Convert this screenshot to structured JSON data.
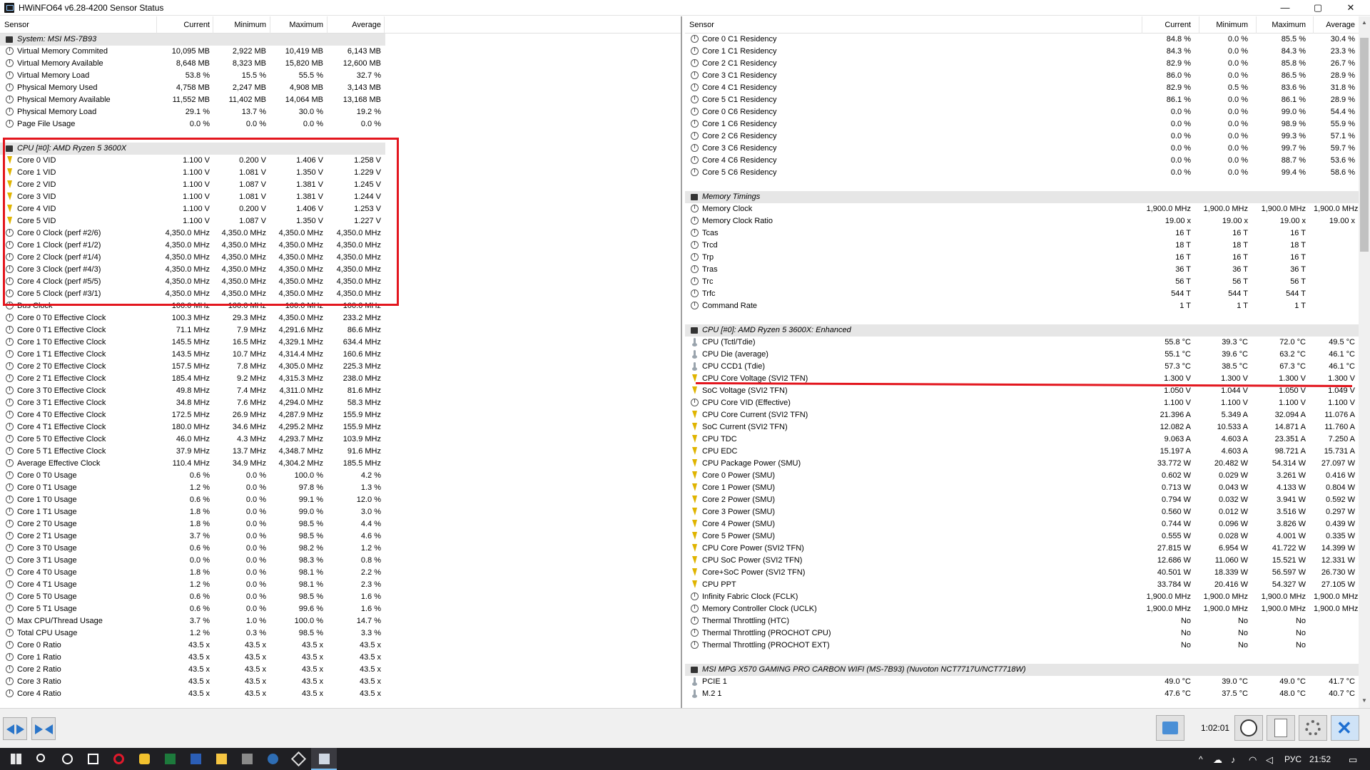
{
  "window": {
    "title": "HWiNFO64 v6.28-4200 Sensor Status",
    "minimize": "—",
    "maximize": "▢",
    "close": "✕"
  },
  "columns": {
    "sensor": "Sensor",
    "current": "Current",
    "minimum": "Minimum",
    "maximum": "Maximum",
    "average": "Average"
  },
  "left_rows": [
    {
      "t": "g",
      "n": "System: MSI MS-7B93"
    },
    {
      "i": "c",
      "n": "Virtual Memory Commited",
      "v": [
        "10,095 MB",
        "2,922 MB",
        "10,419 MB",
        "6,143 MB"
      ]
    },
    {
      "i": "c",
      "n": "Virtual Memory Available",
      "v": [
        "8,648 MB",
        "8,323 MB",
        "15,820 MB",
        "12,600 MB"
      ]
    },
    {
      "i": "c",
      "n": "Virtual Memory Load",
      "v": [
        "53.8 %",
        "15.5 %",
        "55.5 %",
        "32.7 %"
      ]
    },
    {
      "i": "c",
      "n": "Physical Memory Used",
      "v": [
        "4,758 MB",
        "2,247 MB",
        "4,908 MB",
        "3,143 MB"
      ]
    },
    {
      "i": "c",
      "n": "Physical Memory Available",
      "v": [
        "11,552 MB",
        "11,402 MB",
        "14,064 MB",
        "13,168 MB"
      ]
    },
    {
      "i": "c",
      "n": "Physical Memory Load",
      "v": [
        "29.1 %",
        "13.7 %",
        "30.0 %",
        "19.2 %"
      ]
    },
    {
      "i": "c",
      "n": "Page File Usage",
      "v": [
        "0.0 %",
        "0.0 %",
        "0.0 %",
        "0.0 %"
      ]
    },
    {
      "t": "b"
    },
    {
      "t": "g",
      "n": "CPU [#0]: AMD Ryzen 5 3600X"
    },
    {
      "i": "b",
      "n": "Core 0 VID",
      "v": [
        "1.100 V",
        "0.200 V",
        "1.406 V",
        "1.258 V"
      ]
    },
    {
      "i": "b",
      "n": "Core 1 VID",
      "v": [
        "1.100 V",
        "1.081 V",
        "1.350 V",
        "1.229 V"
      ]
    },
    {
      "i": "b",
      "n": "Core 2 VID",
      "v": [
        "1.100 V",
        "1.087 V",
        "1.381 V",
        "1.245 V"
      ]
    },
    {
      "i": "b",
      "n": "Core 3 VID",
      "v": [
        "1.100 V",
        "1.081 V",
        "1.381 V",
        "1.244 V"
      ]
    },
    {
      "i": "b",
      "n": "Core 4 VID",
      "v": [
        "1.100 V",
        "0.200 V",
        "1.406 V",
        "1.253 V"
      ]
    },
    {
      "i": "b",
      "n": "Core 5 VID",
      "v": [
        "1.100 V",
        "1.087 V",
        "1.350 V",
        "1.227 V"
      ]
    },
    {
      "i": "c",
      "n": "Core 0 Clock (perf #2/6)",
      "v": [
        "4,350.0 MHz",
        "4,350.0 MHz",
        "4,350.0 MHz",
        "4,350.0 MHz"
      ]
    },
    {
      "i": "c",
      "n": "Core 1 Clock (perf #1/2)",
      "v": [
        "4,350.0 MHz",
        "4,350.0 MHz",
        "4,350.0 MHz",
        "4,350.0 MHz"
      ]
    },
    {
      "i": "c",
      "n": "Core 2 Clock (perf #1/4)",
      "v": [
        "4,350.0 MHz",
        "4,350.0 MHz",
        "4,350.0 MHz",
        "4,350.0 MHz"
      ]
    },
    {
      "i": "c",
      "n": "Core 3 Clock (perf #4/3)",
      "v": [
        "4,350.0 MHz",
        "4,350.0 MHz",
        "4,350.0 MHz",
        "4,350.0 MHz"
      ]
    },
    {
      "i": "c",
      "n": "Core 4 Clock (perf #5/5)",
      "v": [
        "4,350.0 MHz",
        "4,350.0 MHz",
        "4,350.0 MHz",
        "4,350.0 MHz"
      ]
    },
    {
      "i": "c",
      "n": "Core 5 Clock (perf #3/1)",
      "v": [
        "4,350.0 MHz",
        "4,350.0 MHz",
        "4,350.0 MHz",
        "4,350.0 MHz"
      ]
    },
    {
      "i": "c",
      "n": "Bus Clock",
      "v": [
        "100.0 MHz",
        "100.0 MHz",
        "100.0 MHz",
        "100.0 MHz"
      ]
    },
    {
      "i": "c",
      "n": "Core 0 T0 Effective Clock",
      "v": [
        "100.3 MHz",
        "29.3 MHz",
        "4,350.0 MHz",
        "233.2 MHz"
      ]
    },
    {
      "i": "c",
      "n": "Core 0 T1 Effective Clock",
      "v": [
        "71.1 MHz",
        "7.9 MHz",
        "4,291.6 MHz",
        "86.6 MHz"
      ]
    },
    {
      "i": "c",
      "n": "Core 1 T0 Effective Clock",
      "v": [
        "145.5 MHz",
        "16.5 MHz",
        "4,329.1 MHz",
        "634.4 MHz"
      ]
    },
    {
      "i": "c",
      "n": "Core 1 T1 Effective Clock",
      "v": [
        "143.5 MHz",
        "10.7 MHz",
        "4,314.4 MHz",
        "160.6 MHz"
      ]
    },
    {
      "i": "c",
      "n": "Core 2 T0 Effective Clock",
      "v": [
        "157.5 MHz",
        "7.8 MHz",
        "4,305.0 MHz",
        "225.3 MHz"
      ]
    },
    {
      "i": "c",
      "n": "Core 2 T1 Effective Clock",
      "v": [
        "185.4 MHz",
        "9.2 MHz",
        "4,315.3 MHz",
        "238.0 MHz"
      ]
    },
    {
      "i": "c",
      "n": "Core 3 T0 Effective Clock",
      "v": [
        "49.8 MHz",
        "7.4 MHz",
        "4,311.0 MHz",
        "81.6 MHz"
      ]
    },
    {
      "i": "c",
      "n": "Core 3 T1 Effective Clock",
      "v": [
        "34.8 MHz",
        "7.6 MHz",
        "4,294.0 MHz",
        "58.3 MHz"
      ]
    },
    {
      "i": "c",
      "n": "Core 4 T0 Effective Clock",
      "v": [
        "172.5 MHz",
        "26.9 MHz",
        "4,287.9 MHz",
        "155.9 MHz"
      ]
    },
    {
      "i": "c",
      "n": "Core 4 T1 Effective Clock",
      "v": [
        "180.0 MHz",
        "34.6 MHz",
        "4,295.2 MHz",
        "155.9 MHz"
      ]
    },
    {
      "i": "c",
      "n": "Core 5 T0 Effective Clock",
      "v": [
        "46.0 MHz",
        "4.3 MHz",
        "4,293.7 MHz",
        "103.9 MHz"
      ]
    },
    {
      "i": "c",
      "n": "Core 5 T1 Effective Clock",
      "v": [
        "37.9 MHz",
        "13.7 MHz",
        "4,348.7 MHz",
        "91.6 MHz"
      ]
    },
    {
      "i": "c",
      "n": "Average Effective Clock",
      "v": [
        "110.4 MHz",
        "34.9 MHz",
        "4,304.2 MHz",
        "185.5 MHz"
      ]
    },
    {
      "i": "c",
      "n": "Core 0 T0 Usage",
      "v": [
        "0.6 %",
        "0.0 %",
        "100.0 %",
        "4.2 %"
      ]
    },
    {
      "i": "c",
      "n": "Core 0 T1 Usage",
      "v": [
        "1.2 %",
        "0.0 %",
        "97.8 %",
        "1.3 %"
      ]
    },
    {
      "i": "c",
      "n": "Core 1 T0 Usage",
      "v": [
        "0.6 %",
        "0.0 %",
        "99.1 %",
        "12.0 %"
      ]
    },
    {
      "i": "c",
      "n": "Core 1 T1 Usage",
      "v": [
        "1.8 %",
        "0.0 %",
        "99.0 %",
        "3.0 %"
      ]
    },
    {
      "i": "c",
      "n": "Core 2 T0 Usage",
      "v": [
        "1.8 %",
        "0.0 %",
        "98.5 %",
        "4.4 %"
      ]
    },
    {
      "i": "c",
      "n": "Core 2 T1 Usage",
      "v": [
        "3.7 %",
        "0.0 %",
        "98.5 %",
        "4.6 %"
      ]
    },
    {
      "i": "c",
      "n": "Core 3 T0 Usage",
      "v": [
        "0.6 %",
        "0.0 %",
        "98.2 %",
        "1.2 %"
      ]
    },
    {
      "i": "c",
      "n": "Core 3 T1 Usage",
      "v": [
        "0.0 %",
        "0.0 %",
        "98.3 %",
        "0.8 %"
      ]
    },
    {
      "i": "c",
      "n": "Core 4 T0 Usage",
      "v": [
        "1.8 %",
        "0.0 %",
        "98.1 %",
        "2.2 %"
      ]
    },
    {
      "i": "c",
      "n": "Core 4 T1 Usage",
      "v": [
        "1.2 %",
        "0.0 %",
        "98.1 %",
        "2.3 %"
      ]
    },
    {
      "i": "c",
      "n": "Core 5 T0 Usage",
      "v": [
        "0.6 %",
        "0.0 %",
        "98.5 %",
        "1.6 %"
      ]
    },
    {
      "i": "c",
      "n": "Core 5 T1 Usage",
      "v": [
        "0.6 %",
        "0.0 %",
        "99.6 %",
        "1.6 %"
      ]
    },
    {
      "i": "c",
      "n": "Max CPU/Thread Usage",
      "v": [
        "3.7 %",
        "1.0 %",
        "100.0 %",
        "14.7 %"
      ]
    },
    {
      "i": "c",
      "n": "Total CPU Usage",
      "v": [
        "1.2 %",
        "0.3 %",
        "98.5 %",
        "3.3 %"
      ]
    },
    {
      "i": "c",
      "n": "Core 0 Ratio",
      "v": [
        "43.5 x",
        "43.5 x",
        "43.5 x",
        "43.5 x"
      ]
    },
    {
      "i": "c",
      "n": "Core 1 Ratio",
      "v": [
        "43.5 x",
        "43.5 x",
        "43.5 x",
        "43.5 x"
      ]
    },
    {
      "i": "c",
      "n": "Core 2 Ratio",
      "v": [
        "43.5 x",
        "43.5 x",
        "43.5 x",
        "43.5 x"
      ]
    },
    {
      "i": "c",
      "n": "Core 3 Ratio",
      "v": [
        "43.5 x",
        "43.5 x",
        "43.5 x",
        "43.5 x"
      ]
    },
    {
      "i": "c",
      "n": "Core 4 Ratio",
      "v": [
        "43.5 x",
        "43.5 x",
        "43.5 x",
        "43.5 x"
      ]
    }
  ],
  "right_rows": [
    {
      "i": "c",
      "n": "Core 0 C1 Residency",
      "v": [
        "84.8 %",
        "0.0 %",
        "85.5 %",
        "30.4 %"
      ]
    },
    {
      "i": "c",
      "n": "Core 1 C1 Residency",
      "v": [
        "84.3 %",
        "0.0 %",
        "84.3 %",
        "23.3 %"
      ]
    },
    {
      "i": "c",
      "n": "Core 2 C1 Residency",
      "v": [
        "82.9 %",
        "0.0 %",
        "85.8 %",
        "26.7 %"
      ]
    },
    {
      "i": "c",
      "n": "Core 3 C1 Residency",
      "v": [
        "86.0 %",
        "0.0 %",
        "86.5 %",
        "28.9 %"
      ]
    },
    {
      "i": "c",
      "n": "Core 4 C1 Residency",
      "v": [
        "82.9 %",
        "0.5 %",
        "83.6 %",
        "31.8 %"
      ]
    },
    {
      "i": "c",
      "n": "Core 5 C1 Residency",
      "v": [
        "86.1 %",
        "0.0 %",
        "86.1 %",
        "28.9 %"
      ]
    },
    {
      "i": "c",
      "n": "Core 0 C6 Residency",
      "v": [
        "0.0 %",
        "0.0 %",
        "99.0 %",
        "54.4 %"
      ]
    },
    {
      "i": "c",
      "n": "Core 1 C6 Residency",
      "v": [
        "0.0 %",
        "0.0 %",
        "98.9 %",
        "55.9 %"
      ]
    },
    {
      "i": "c",
      "n": "Core 2 C6 Residency",
      "v": [
        "0.0 %",
        "0.0 %",
        "99.3 %",
        "57.1 %"
      ]
    },
    {
      "i": "c",
      "n": "Core 3 C6 Residency",
      "v": [
        "0.0 %",
        "0.0 %",
        "99.7 %",
        "59.7 %"
      ]
    },
    {
      "i": "c",
      "n": "Core 4 C6 Residency",
      "v": [
        "0.0 %",
        "0.0 %",
        "88.7 %",
        "53.6 %"
      ]
    },
    {
      "i": "c",
      "n": "Core 5 C6 Residency",
      "v": [
        "0.0 %",
        "0.0 %",
        "99.4 %",
        "58.6 %"
      ]
    },
    {
      "t": "b"
    },
    {
      "t": "g",
      "n": "Memory Timings"
    },
    {
      "i": "c",
      "n": "Memory Clock",
      "v": [
        "1,900.0 MHz",
        "1,900.0 MHz",
        "1,900.0 MHz",
        "1,900.0 MHz"
      ]
    },
    {
      "i": "c",
      "n": "Memory Clock Ratio",
      "v": [
        "19.00 x",
        "19.00 x",
        "19.00 x",
        "19.00 x"
      ]
    },
    {
      "i": "c",
      "n": "Tcas",
      "v": [
        "16 T",
        "16 T",
        "16 T",
        ""
      ]
    },
    {
      "i": "c",
      "n": "Trcd",
      "v": [
        "18 T",
        "18 T",
        "18 T",
        ""
      ]
    },
    {
      "i": "c",
      "n": "Trp",
      "v": [
        "16 T",
        "16 T",
        "16 T",
        ""
      ]
    },
    {
      "i": "c",
      "n": "Tras",
      "v": [
        "36 T",
        "36 T",
        "36 T",
        ""
      ]
    },
    {
      "i": "c",
      "n": "Trc",
      "v": [
        "56 T",
        "56 T",
        "56 T",
        ""
      ]
    },
    {
      "i": "c",
      "n": "Trfc",
      "v": [
        "544 T",
        "544 T",
        "544 T",
        ""
      ]
    },
    {
      "i": "c",
      "n": "Command Rate",
      "v": [
        "1 T",
        "1 T",
        "1 T",
        ""
      ]
    },
    {
      "t": "b"
    },
    {
      "t": "g",
      "n": "CPU [#0]: AMD Ryzen 5 3600X: Enhanced"
    },
    {
      "i": "t",
      "n": "CPU (Tctl/Tdie)",
      "v": [
        "55.8 °C",
        "39.3 °C",
        "72.0 °C",
        "49.5 °C"
      ]
    },
    {
      "i": "t",
      "n": "CPU Die (average)",
      "v": [
        "55.1 °C",
        "39.6 °C",
        "63.2 °C",
        "46.1 °C"
      ]
    },
    {
      "i": "t",
      "n": "CPU CCD1 (Tdie)",
      "v": [
        "57.3 °C",
        "38.5 °C",
        "67.3 °C",
        "46.1 °C"
      ]
    },
    {
      "i": "b",
      "n": "CPU Core Voltage (SVI2 TFN)",
      "v": [
        "1.300 V",
        "1.300 V",
        "1.300 V",
        "1.300 V"
      ]
    },
    {
      "i": "b",
      "n": "SoC Voltage (SVI2 TFN)",
      "v": [
        "1.050 V",
        "1.044 V",
        "1.050 V",
        "1.049 V"
      ]
    },
    {
      "i": "c",
      "n": "CPU Core VID (Effective)",
      "v": [
        "1.100 V",
        "1.100 V",
        "1.100 V",
        "1.100 V"
      ]
    },
    {
      "i": "b",
      "n": "CPU Core Current (SVI2 TFN)",
      "v": [
        "21.396 A",
        "5.349 A",
        "32.094 A",
        "11.076 A"
      ]
    },
    {
      "i": "b",
      "n": "SoC Current (SVI2 TFN)",
      "v": [
        "12.082 A",
        "10.533 A",
        "14.871 A",
        "11.760 A"
      ]
    },
    {
      "i": "b",
      "n": "CPU TDC",
      "v": [
        "9.063 A",
        "4.603 A",
        "23.351 A",
        "7.250 A"
      ]
    },
    {
      "i": "b",
      "n": "CPU EDC",
      "v": [
        "15.197 A",
        "4.603 A",
        "98.721 A",
        "15.731 A"
      ]
    },
    {
      "i": "b",
      "n": "CPU Package Power (SMU)",
      "v": [
        "33.772 W",
        "20.482 W",
        "54.314 W",
        "27.097 W"
      ]
    },
    {
      "i": "b",
      "n": "Core 0 Power (SMU)",
      "v": [
        "0.602 W",
        "0.029 W",
        "3.261 W",
        "0.416 W"
      ]
    },
    {
      "i": "b",
      "n": "Core 1 Power (SMU)",
      "v": [
        "0.713 W",
        "0.043 W",
        "4.133 W",
        "0.804 W"
      ]
    },
    {
      "i": "b",
      "n": "Core 2 Power (SMU)",
      "v": [
        "0.794 W",
        "0.032 W",
        "3.941 W",
        "0.592 W"
      ]
    },
    {
      "i": "b",
      "n": "Core 3 Power (SMU)",
      "v": [
        "0.560 W",
        "0.012 W",
        "3.516 W",
        "0.297 W"
      ]
    },
    {
      "i": "b",
      "n": "Core 4 Power (SMU)",
      "v": [
        "0.744 W",
        "0.096 W",
        "3.826 W",
        "0.439 W"
      ]
    },
    {
      "i": "b",
      "n": "Core 5 Power (SMU)",
      "v": [
        "0.555 W",
        "0.028 W",
        "4.001 W",
        "0.335 W"
      ]
    },
    {
      "i": "b",
      "n": "CPU Core Power (SVI2 TFN)",
      "v": [
        "27.815 W",
        "6.954 W",
        "41.722 W",
        "14.399 W"
      ]
    },
    {
      "i": "b",
      "n": "CPU SoC Power (SVI2 TFN)",
      "v": [
        "12.686 W",
        "11.060 W",
        "15.521 W",
        "12.331 W"
      ]
    },
    {
      "i": "b",
      "n": "Core+SoC Power (SVI2 TFN)",
      "v": [
        "40.501 W",
        "18.339 W",
        "56.597 W",
        "26.730 W"
      ]
    },
    {
      "i": "b",
      "n": "CPU PPT",
      "v": [
        "33.784 W",
        "20.416 W",
        "54.327 W",
        "27.105 W"
      ]
    },
    {
      "i": "c",
      "n": "Infinity Fabric Clock (FCLK)",
      "v": [
        "1,900.0 MHz",
        "1,900.0 MHz",
        "1,900.0 MHz",
        "1,900.0 MHz"
      ]
    },
    {
      "i": "c",
      "n": "Memory Controller Clock (UCLK)",
      "v": [
        "1,900.0 MHz",
        "1,900.0 MHz",
        "1,900.0 MHz",
        "1,900.0 MHz"
      ]
    },
    {
      "i": "c",
      "n": "Thermal Throttling (HTC)",
      "v": [
        "No",
        "No",
        "No",
        ""
      ]
    },
    {
      "i": "c",
      "n": "Thermal Throttling (PROCHOT CPU)",
      "v": [
        "No",
        "No",
        "No",
        ""
      ]
    },
    {
      "i": "c",
      "n": "Thermal Throttling (PROCHOT EXT)",
      "v": [
        "No",
        "No",
        "No",
        ""
      ]
    },
    {
      "t": "b"
    },
    {
      "t": "g",
      "n": "MSI MPG X570 GAMING PRO CARBON WIFI (MS-7B93) (Nuvoton NCT7717U/NCT7718W)"
    },
    {
      "i": "t",
      "n": "PCIE 1",
      "v": [
        "49.0 °C",
        "39.0 °C",
        "49.0 °C",
        "41.7 °C"
      ]
    },
    {
      "i": "t",
      "n": "M.2 1",
      "v": [
        "47.6 °C",
        "37.5 °C",
        "48.0 °C",
        "40.7 °C"
      ]
    }
  ],
  "bottom": {
    "elapsed": "1:02:01"
  },
  "taskbar": {
    "lang": "РУС",
    "time": "21:52"
  },
  "colors": {
    "highlight": "#e3161e",
    "accent": "#1e6fd1"
  }
}
